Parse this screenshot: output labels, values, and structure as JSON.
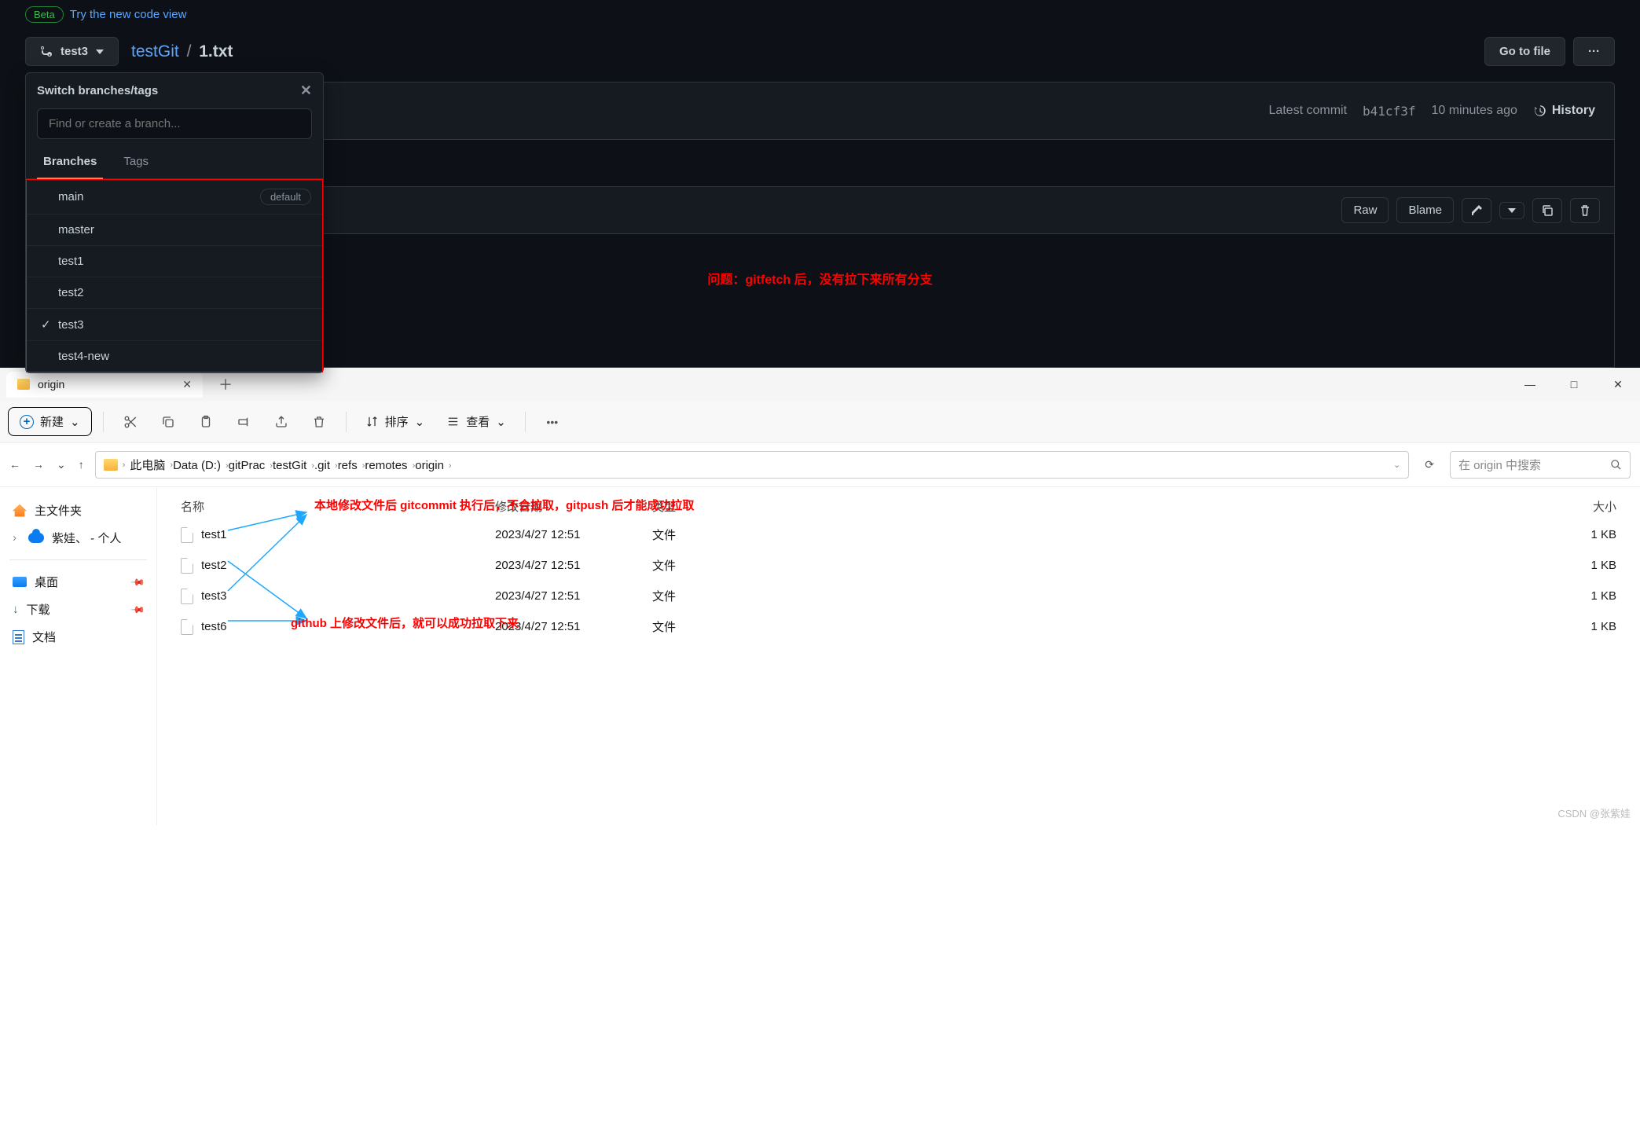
{
  "github": {
    "beta_label": "Beta",
    "beta_link": "Try the new code view",
    "branch_button": "test3",
    "repo": "testGit",
    "file": "1.txt",
    "go_to_file": "Go to file",
    "more": "···",
    "latest_commit_prefix": "Latest commit",
    "commit_hash": "b41cf3f",
    "commit_time": "10 minutes ago",
    "history": "History",
    "raw": "Raw",
    "blame": "Blame",
    "popover": {
      "title": "Switch branches/tags",
      "search_placeholder": "Find or create a branch...",
      "tab_branches": "Branches",
      "tab_tags": "Tags",
      "default_label": "default",
      "items": [
        {
          "name": "main",
          "default": true,
          "checked": false
        },
        {
          "name": "master",
          "default": false,
          "checked": false
        },
        {
          "name": "test1",
          "default": false,
          "checked": false
        },
        {
          "name": "test2",
          "default": false,
          "checked": false
        },
        {
          "name": "test3",
          "default": false,
          "checked": true
        },
        {
          "name": "test4-new",
          "default": false,
          "checked": false
        }
      ]
    },
    "annotation": "问题：gitfetch 后，没有拉下来所有分支"
  },
  "explorer": {
    "tab_title": "origin",
    "new_button": "新建",
    "sort": "排序",
    "view": "查看",
    "breadcrumb": [
      "此电脑",
      "Data (D:)",
      "gitPrac",
      "testGit",
      ".git",
      "refs",
      "remotes",
      "origin"
    ],
    "search_placeholder": "在 origin 中搜索",
    "side": {
      "home": "主文件夹",
      "onedrive": "紫娃、 - 个人",
      "desktop": "桌面",
      "downloads": "下载",
      "documents": "文档"
    },
    "columns": {
      "name": "名称",
      "date": "修改日期",
      "type": "类型",
      "size": "大小"
    },
    "files": [
      {
        "name": "test1",
        "date": "2023/4/27 12:51",
        "type": "文件",
        "size": "1 KB"
      },
      {
        "name": "test2",
        "date": "2023/4/27 12:51",
        "type": "文件",
        "size": "1 KB"
      },
      {
        "name": "test3",
        "date": "2023/4/27 12:51",
        "type": "文件",
        "size": "1 KB"
      },
      {
        "name": "test6",
        "date": "2023/4/27 12:51",
        "type": "文件",
        "size": "1 KB"
      }
    ],
    "annot1": "本地修改文件后 gitcommit 执行后，不会拉取，gitpush 后才能成功拉取",
    "annot2": "github 上修改文件后，就可以成功拉取下来",
    "watermark": "CSDN @张紫娃"
  }
}
